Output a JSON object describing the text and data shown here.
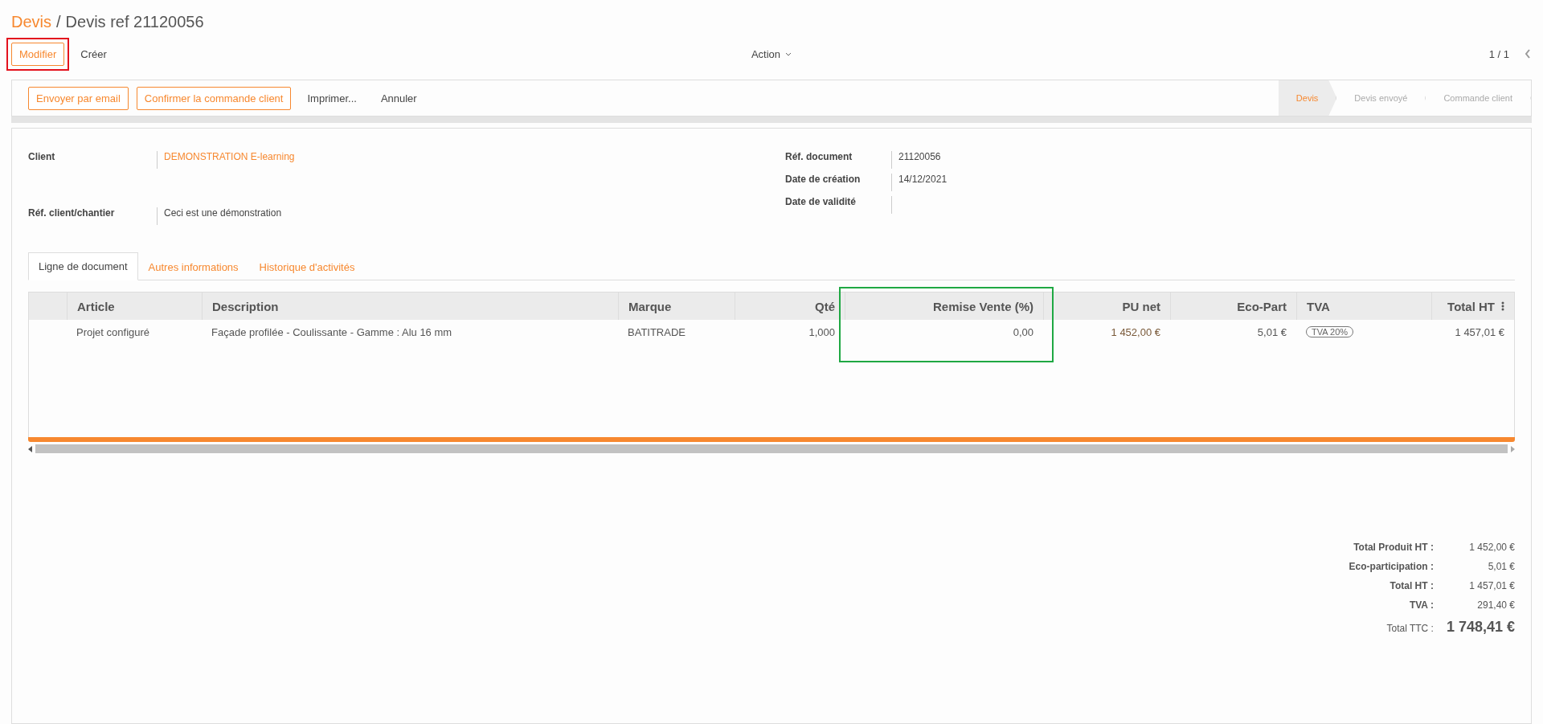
{
  "breadcrumb": {
    "parent": "Devis",
    "separator": "/",
    "current": "Devis ref 21120056"
  },
  "control_buttons": [
    {
      "label": "Modifier",
      "kind": "primary",
      "color": "#e3121d"
    },
    {
      "label": "Créer",
      "kind": "link"
    }
  ],
  "action_menu": "Action",
  "pager": "1 / 1",
  "status_buttons": [
    {
      "label": "Envoyer par email",
      "kind": "outline"
    },
    {
      "label": "Confirmer la commande client",
      "kind": "outline"
    },
    {
      "label": "Imprimer...",
      "kind": "link"
    },
    {
      "label": "Annuler",
      "kind": "link"
    }
  ],
  "status_steps": [
    {
      "label": "Devis",
      "selected": true
    },
    {
      "label": "Devis envoyé",
      "selected": false
    },
    {
      "label": "Commande client",
      "selected": false
    }
  ],
  "fields_left": [
    {
      "label": "Client",
      "value": "DEMONSTRATION E-learning",
      "kind": "link"
    },
    {
      "label": "Réf. client/chantier",
      "value": "Ceci est une démonstration",
      "kind": "text"
    }
  ],
  "fields_right": [
    {
      "label": "Réf. document",
      "value": "21120056"
    },
    {
      "label": "Date de création",
      "value": "14/12/2021"
    },
    {
      "label": "Date de validité"
    }
  ],
  "tabs": [
    {
      "label": "Ligne de document",
      "selected": true
    },
    {
      "label": "Autres informations",
      "selected": false
    },
    {
      "label": "Historique d'activités",
      "selected": false
    }
  ],
  "table": {
    "columns": [
      {
        "label": "Article",
        "kind": "text"
      },
      {
        "label": "Description",
        "kind": "text"
      },
      {
        "label": "Marque",
        "kind": "text"
      },
      {
        "label": "Qté",
        "kind": "number"
      },
      {
        "label": "Remise Vente (%)",
        "kind": "number",
        "color": "#1fa843"
      },
      {
        "label": "PU net",
        "kind": "number"
      },
      {
        "label": "Eco-Part",
        "kind": "number"
      },
      {
        "label": "TVA",
        "kind": "tag"
      },
      {
        "label": "Total HT",
        "kind": "number"
      }
    ],
    "rows": [
      {
        "cells": [
          "Projet configuré",
          "Façade profilée - Coulissante - Gamme : Alu 16 mm",
          "BATITRADE",
          "1,000",
          "0,00",
          "1 452,00 €",
          "5,01 €",
          "TVA 20%",
          "1 457,01 €"
        ]
      }
    ]
  },
  "totals": [
    {
      "label": "Total Produit HT :",
      "value": "1 452,00 €",
      "kind": "normal"
    },
    {
      "label": "Eco-participation :",
      "value": "5,01 €",
      "kind": "normal"
    },
    {
      "label": "Total HT :",
      "value": "1 457,01 €",
      "kind": "normal"
    },
    {
      "label": "TVA :",
      "value": "291,40 €",
      "kind": "normal"
    },
    {
      "label": "Total TTC :",
      "value": "1 748,41 €",
      "kind": "grand"
    }
  ]
}
